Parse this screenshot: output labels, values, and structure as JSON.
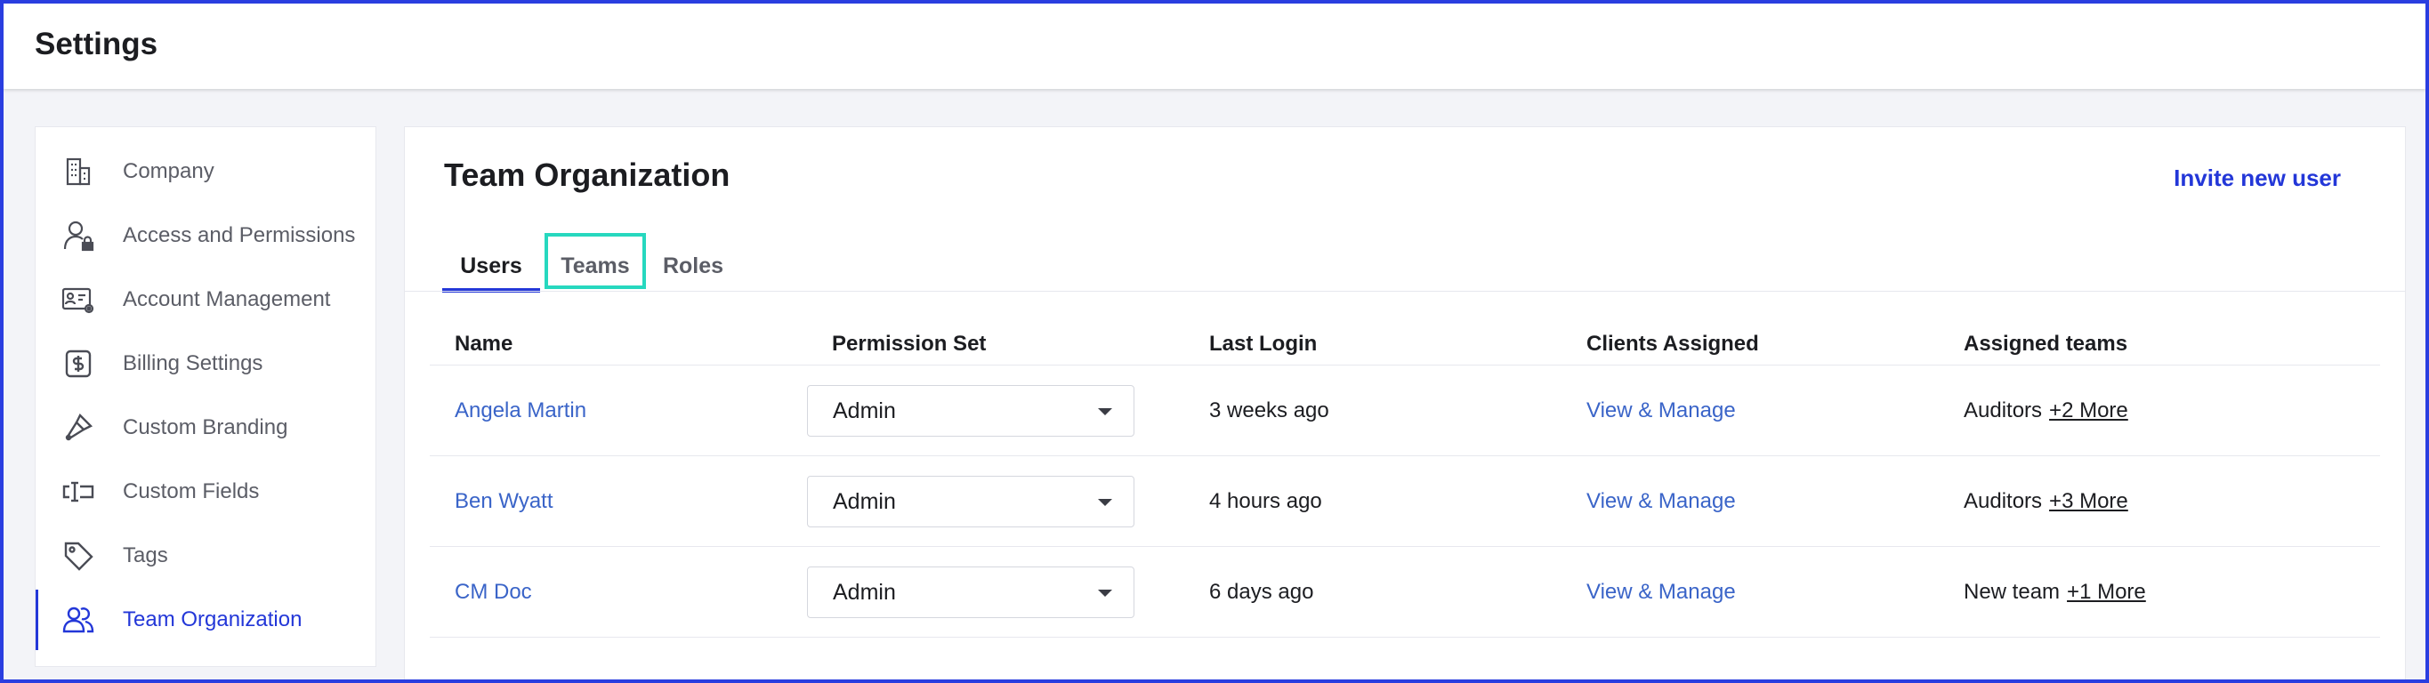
{
  "header": {
    "title": "Settings"
  },
  "sidebar": {
    "items": [
      {
        "label": "Company",
        "icon": "building-icon",
        "active": false
      },
      {
        "label": "Access and Permissions",
        "icon": "user-lock-icon",
        "active": false
      },
      {
        "label": "Account Management",
        "icon": "id-card-gear-icon",
        "active": false
      },
      {
        "label": "Billing Settings",
        "icon": "dollar-badge-icon",
        "active": false
      },
      {
        "label": "Custom Branding",
        "icon": "paint-brush-icon",
        "active": false
      },
      {
        "label": "Custom Fields",
        "icon": "text-field-icon",
        "active": false
      },
      {
        "label": "Tags",
        "icon": "tag-icon",
        "active": false
      },
      {
        "label": "Team Organization",
        "icon": "team-users-icon",
        "active": true
      }
    ]
  },
  "main": {
    "title": "Team Organization",
    "invite_label": "Invite new user",
    "tabs": [
      {
        "label": "Users",
        "active": true
      },
      {
        "label": "Teams",
        "active": false,
        "highlighted": true
      },
      {
        "label": "Roles",
        "active": false
      }
    ],
    "table": {
      "columns": [
        "Name",
        "Permission Set",
        "Last Login",
        "Clients Assigned",
        "Assigned teams"
      ],
      "rows": [
        {
          "name": "Angela Martin",
          "permission": "Admin",
          "last_login": "3 weeks ago",
          "clients": "View & Manage",
          "team": "Auditors",
          "more": "+2 More"
        },
        {
          "name": "Ben Wyatt",
          "permission": "Admin",
          "last_login": "4 hours ago",
          "clients": "View & Manage",
          "team": "Auditors",
          "more": "+3 More"
        },
        {
          "name": "CM Doc",
          "permission": "Admin",
          "last_login": "6 days ago",
          "clients": "View & Manage",
          "team": "New team",
          "more": "+1 More"
        }
      ]
    }
  },
  "colors": {
    "accent": "#2337d8",
    "link": "#3a64c8",
    "highlight": "#27d8bf",
    "frame": "#2a3ee0"
  }
}
